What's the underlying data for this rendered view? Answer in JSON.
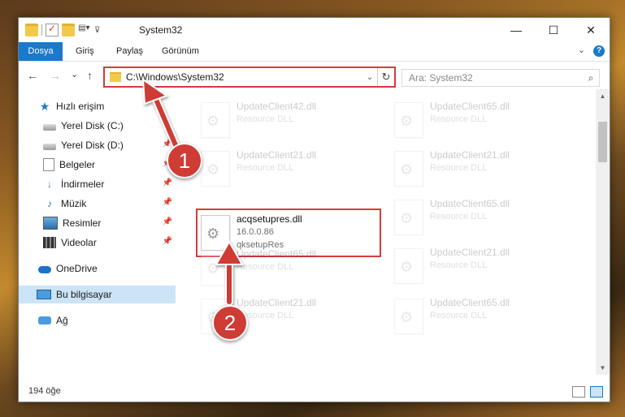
{
  "window": {
    "title": "System32",
    "quick_access_toolbar": [
      "folder-icon",
      "properties-icon",
      "new-folder-icon",
      "customize-icon"
    ]
  },
  "controls": {
    "minimize": "—",
    "maximize": "☐",
    "close": "✕"
  },
  "ribbon": {
    "tabs": [
      "Dosya",
      "Giriş",
      "Paylaş",
      "Görünüm"
    ],
    "expand_glyph": "⌄",
    "help_glyph": "?"
  },
  "nav": {
    "back": "←",
    "forward": "→",
    "recent": "⌄",
    "up": "↑",
    "address": "C:\\Windows\\System32",
    "address_dropdown": "⌄",
    "refresh": "↻",
    "search_placeholder": "Ara: System32",
    "search_icon": "⌕"
  },
  "sidebar": {
    "items": [
      {
        "label": "Hızlı erişim",
        "icon": "star-icon",
        "pinned": false
      },
      {
        "label": "Yerel Disk (C:)",
        "icon": "disk-icon",
        "pinned": false
      },
      {
        "label": "Yerel Disk (D:)",
        "icon": "disk-icon",
        "pinned": true
      },
      {
        "label": "Belgeler",
        "icon": "documents-icon",
        "pinned": true
      },
      {
        "label": "İndirmeler",
        "icon": "downloads-icon",
        "pinned": true
      },
      {
        "label": "Müzik",
        "icon": "music-icon",
        "pinned": true
      },
      {
        "label": "Resimler",
        "icon": "pictures-icon",
        "pinned": true
      },
      {
        "label": "Videolar",
        "icon": "videos-icon",
        "pinned": true
      },
      {
        "label": "OneDrive",
        "icon": "cloud-icon",
        "pinned": false
      },
      {
        "label": "Bu bilgisayar",
        "icon": "computer-icon",
        "pinned": false,
        "selected": true
      },
      {
        "label": "Ağ",
        "icon": "network-icon",
        "pinned": false
      }
    ]
  },
  "files": [
    {
      "name": "UpdateClient42.dll",
      "line2": "Resource DLL",
      "line3": "",
      "faded": true
    },
    {
      "name": "UpdateClient65.dll",
      "line2": "Resource DLL",
      "line3": "",
      "faded": true
    },
    {
      "name": "UpdateClient21.dll",
      "line2": "Resource DLL",
      "line3": "",
      "faded": true
    },
    {
      "name": "UpdateClient21.dll",
      "line2": "Resource DLL",
      "line3": "",
      "faded": true
    },
    {
      "name": "acqsetupres.dll",
      "line2": "16.0.0.86",
      "line3": "qksetupRes",
      "faded": false,
      "highlight": true
    },
    {
      "name": "UpdateClient65.dll",
      "line2": "Resource DLL",
      "line3": "",
      "faded": true
    },
    {
      "name": "UpdateClient65.dll",
      "line2": "Resource DLL",
      "line3": "",
      "faded": true
    },
    {
      "name": "UpdateClient21.dll",
      "line2": "Resource DLL",
      "line3": "",
      "faded": true
    },
    {
      "name": "UpdateClient21.dll",
      "line2": "Resource DLL",
      "line3": "",
      "faded": true
    },
    {
      "name": "UpdateClient65.dll",
      "line2": "Resource DLL",
      "line3": "",
      "faded": true
    }
  ],
  "status": {
    "count": "194 öğe"
  },
  "annotations": {
    "step1": "1",
    "step2": "2",
    "accent_color": "#cf3b35"
  }
}
